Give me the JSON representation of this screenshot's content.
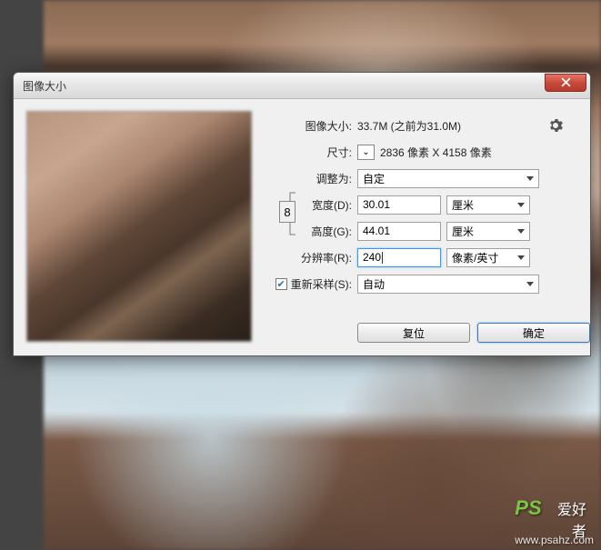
{
  "dialog": {
    "title": "图像大小",
    "close": "×"
  },
  "info": {
    "size_label": "图像大小:",
    "size_value": "33.7M (之前为31.0M)",
    "dim_label": "尺寸:",
    "dim_value": "2836 像素 X 4158 像素"
  },
  "fit": {
    "label": "调整为:",
    "value": "自定"
  },
  "width": {
    "label": "宽度(D):",
    "value": "30.01",
    "unit": "厘米"
  },
  "height": {
    "label": "高度(G):",
    "value": "44.01",
    "unit": "厘米"
  },
  "resolution": {
    "label": "分辨率(R):",
    "value": "240",
    "unit": "像素/英寸"
  },
  "resample": {
    "label": "重新采样(S):",
    "checked": true,
    "value": "自动"
  },
  "buttons": {
    "reset": "复位",
    "ok": "确定"
  },
  "icons": {
    "dim_toggle": "⌄",
    "link": "⇕",
    "check": "✔",
    "gear": "gear-icon"
  },
  "watermark": {
    "logo": "PS",
    "text": "爱好者",
    "url": "www.psahz.com"
  }
}
